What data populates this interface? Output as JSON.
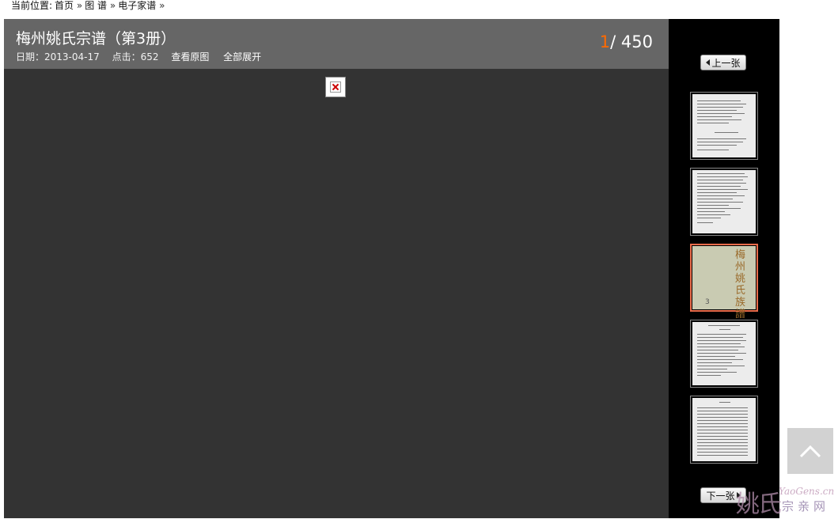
{
  "breadcrumb": {
    "label": "当前位置:",
    "items": [
      "首页",
      "图 谱",
      "电子家谱"
    ],
    "separator": "»"
  },
  "viewer": {
    "title": "梅州姚氏宗谱（第3册）",
    "date_label": "日期：2013-04-17",
    "hits_label": "点击：652",
    "view_original": "查看原图",
    "expand_all": "全部展开",
    "current_page": "1",
    "total_pages": "/ 450"
  },
  "sidebar": {
    "prev_label": "上一张",
    "next_label": "下一张",
    "cover_text": "梅州姚氏族譜",
    "cover_number": "3"
  },
  "watermark": {
    "big": "姚氏",
    "url": "YaoGens.cn",
    "small": "宗亲网"
  },
  "colors": {
    "page_number_accent": "#ff6a00",
    "active_thumb_border": "#e86b4a",
    "viewer_bg": "#333333",
    "header_bg": "#666666"
  }
}
